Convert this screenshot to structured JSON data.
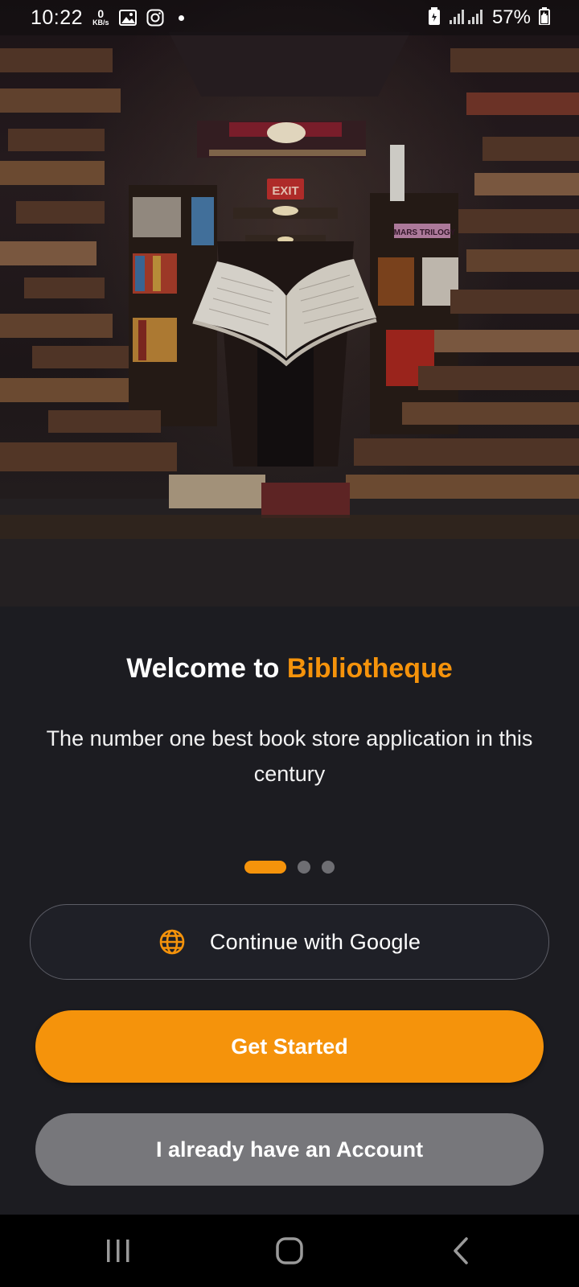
{
  "status_bar": {
    "time": "10:22",
    "net_speed_value": "0",
    "net_speed_unit": "KB/s",
    "battery": "57%",
    "icons": [
      "gallery-icon",
      "instagram-icon",
      "battery-saver-icon",
      "signal-icon",
      "battery-icon"
    ]
  },
  "hero": {
    "exit_sign": "EXIT",
    "book_spine": "MARS TRILOGY"
  },
  "welcome": {
    "prefix": "Welcome to ",
    "brand": "Bibliotheque",
    "subtitle": "The number one best book store application in this century"
  },
  "pager": {
    "pages": 3,
    "active": 1
  },
  "buttons": {
    "google": "Continue with Google",
    "get_started": "Get Started",
    "account": "I already have an Account"
  },
  "colors": {
    "accent": "#f5930b",
    "background": "#1c1c21",
    "secondary_button": "#77777b"
  },
  "nav_bar": {
    "icons": [
      "recents-icon",
      "home-icon",
      "back-icon"
    ]
  }
}
